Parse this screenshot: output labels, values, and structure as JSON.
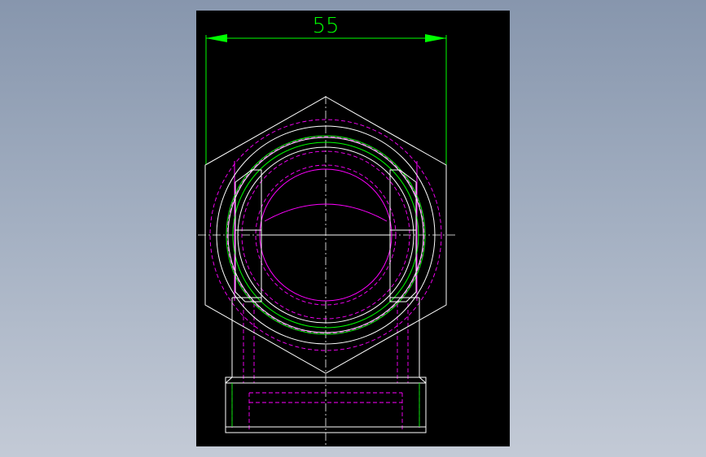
{
  "drawing": {
    "dimension_label": "55",
    "colors": {
      "background": "#000000",
      "outline": "#ffffff",
      "hidden": "#ff00ff",
      "dimension": "#00ff00",
      "centerline": "#ffffff"
    }
  }
}
